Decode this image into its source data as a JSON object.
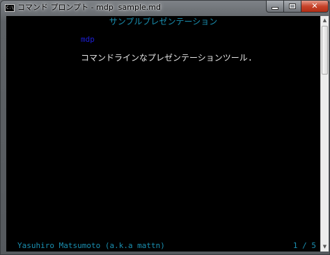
{
  "window": {
    "title": "コマンド プロンプト - mdp  sample.md",
    "app_icon_text": "C:\\",
    "buttons": {
      "minimize": "minimize",
      "maximize": "maximize",
      "close": "✕"
    }
  },
  "slide": {
    "title": "サンプルプレゼンテーション",
    "heading": "mdp",
    "body": "コマンドラインなプレゼンテーションツール.",
    "footer_author": "Yasuhiro Matsumoto (a.k.a mattn)",
    "page_indicator": "1 / 5"
  },
  "scrollbar": {
    "up_arrow": "▲",
    "down_arrow": "▼"
  },
  "colors": {
    "console_bg": "#000000",
    "title_cyan": "#1a8fb0",
    "heading_blue": "#1d1fd8",
    "body_text": "#e6e6e6",
    "close_red": "#c7432a"
  },
  "icons": {
    "app": "console-icon",
    "minimize": "minimize-icon",
    "maximize": "maximize-icon",
    "close": "close-icon"
  }
}
